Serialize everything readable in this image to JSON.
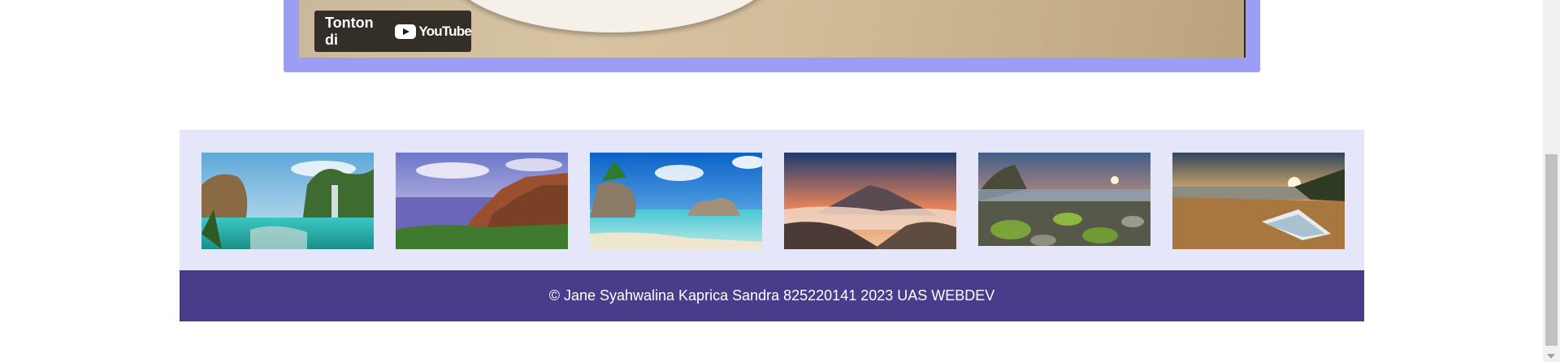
{
  "video": {
    "watch_label": "Tonton di",
    "platform_label": "YouTube",
    "frame_color": "#9c9ef5"
  },
  "gallery": {
    "background": "#e6e6fa",
    "images": [
      {
        "subject": "waterfall-lagoon"
      },
      {
        "subject": "coastal-cliffs"
      },
      {
        "subject": "tropical-beach-boulders"
      },
      {
        "subject": "volcano-sunrise"
      },
      {
        "subject": "mossy-rock-shore"
      },
      {
        "subject": "beach-boat-sunset"
      }
    ]
  },
  "footer": {
    "text": "© Jane Syahwalina Kaprica Sandra 825220141 2023 UAS WEBDEV",
    "background": "#483d8b"
  }
}
